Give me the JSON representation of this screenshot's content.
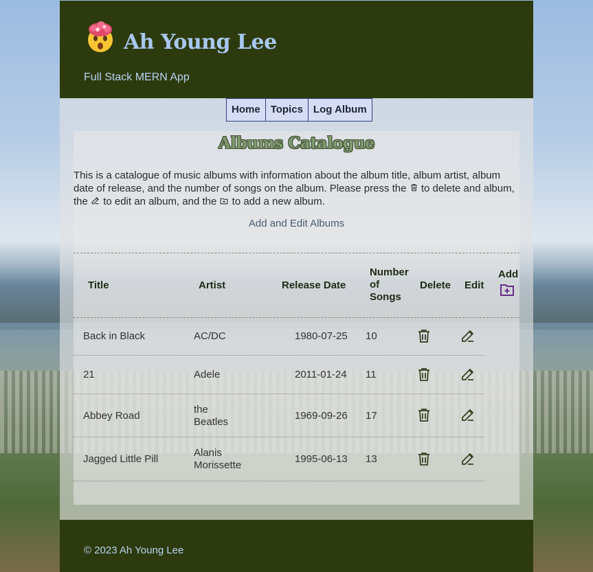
{
  "header": {
    "title": "Ah Young Lee",
    "subtitle": "Full Stack MERN App",
    "logo_icon": "exploding-head-emoji"
  },
  "nav": {
    "items": [
      "Home",
      "Topics",
      "Log Album"
    ]
  },
  "main": {
    "title": "Albums Catalogue",
    "description_parts": [
      "This is a catalogue of music albums with information about the album title, album artist, album date of release, and the number of songs on the album. Please press the ",
      " to delete and album, the ",
      " to edit an album, and the ",
      " to add a new album."
    ],
    "add_edit_link": "Add and Edit Albums"
  },
  "table": {
    "headers": {
      "title": "Title",
      "artist": "Artist",
      "release_date": "Release Date",
      "number_of_songs": "Number of Songs",
      "delete": "Delete",
      "edit": "Edit",
      "add": "Add"
    },
    "rows": [
      {
        "title": "Back in Black",
        "artist": "AC/DC",
        "release_date": "1980-07-25",
        "songs": "10"
      },
      {
        "title": "21",
        "artist": "Adele",
        "release_date": "2011-01-24",
        "songs": "11"
      },
      {
        "title": "Abbey Road",
        "artist": "the Beatles",
        "release_date": "1969-09-26",
        "songs": "17"
      },
      {
        "title": "Jagged Little Pill",
        "artist": "Alanis Morissette",
        "release_date": "1995-06-13",
        "songs": "13"
      }
    ]
  },
  "footer": {
    "text": "© 2023 Ah Young Lee"
  },
  "colors": {
    "header_bg": "#2d3a0d",
    "title_text": "#a8c8f0",
    "nav_bg": "#d6dcf4",
    "add_icon": "#6a2a8a"
  },
  "icons": {
    "delete": "trash-icon",
    "edit": "edit-icon",
    "add": "folder-plus-icon"
  }
}
